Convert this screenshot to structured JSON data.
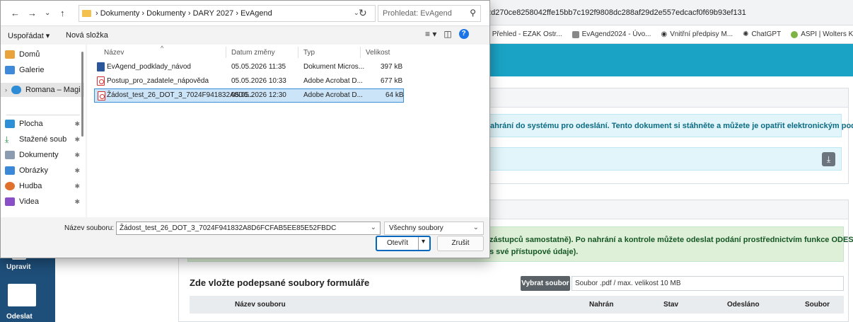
{
  "browser": {
    "url_fragment": "2d270ce8258042ffe15bb7c192f9808dc288af29d2e557edcacf0f69b93ef131",
    "bookmarks": [
      {
        "label": "Přehled - EZAK Ostr...",
        "icon": "play-icon"
      },
      {
        "label": "EvAgend2024 - Úvo...",
        "icon": "evagend-icon"
      },
      {
        "label": "Vnitřní předpisy M...",
        "icon": "globe-icon"
      },
      {
        "label": "ChatGPT",
        "icon": "chatgpt-icon"
      },
      {
        "label": "ASPI | Wolters Kluw...",
        "icon": "aspi-icon"
      }
    ]
  },
  "page": {
    "info_text": "ahrání do systému pro odeslání. Tento dokument si stáhněte a můžete je opatřit elektronickým podpisem.",
    "success_line1": "zástupců samostatně). Po nahrání a kontrole můžete odeslat podání prostřednictvím funkce ODESLAT.",
    "success_line2": "s své přístupové údaje).",
    "upload_title": "Zde vložte podepsané soubory formuláře",
    "pick_button": "Vybrat soubor",
    "pick_placeholder": "Soubor .pdf / max. velikost 10 MB",
    "table_headers": [
      "Název souboru",
      "Nahrán",
      "Stav",
      "Odesláno",
      "Soubor"
    ],
    "sidebar": {
      "edit_label": "Upravit",
      "send_label": "Odeslat"
    }
  },
  "dialog": {
    "breadcrumb": [
      "Dokumenty",
      "Dokumenty",
      "DARY 2027",
      "EvAgend"
    ],
    "search_placeholder": "Prohledat: EvAgend",
    "toolbar": {
      "organize": "Uspořádat ▾",
      "new_folder": "Nová složka"
    },
    "nav_items": [
      {
        "label": "Domů",
        "icon": "home-icon",
        "pinned": false
      },
      {
        "label": "Galerie",
        "icon": "gallery-icon",
        "pinned": false
      },
      {
        "label": "Romana – Magi",
        "icon": "cloud-icon",
        "pinned": false
      },
      {
        "label": "Plocha",
        "icon": "desktop-icon",
        "pinned": true
      },
      {
        "label": "Stažené soub",
        "icon": "download-icon",
        "pinned": true
      },
      {
        "label": "Dokumenty",
        "icon": "documents-icon",
        "pinned": true
      },
      {
        "label": "Obrázky",
        "icon": "pictures-icon",
        "pinned": true
      },
      {
        "label": "Hudba",
        "icon": "music-icon",
        "pinned": true
      },
      {
        "label": "Videa",
        "icon": "videos-icon",
        "pinned": true
      }
    ],
    "columns": {
      "name": "Název",
      "date": "Datum změny",
      "type": "Typ",
      "size": "Velikost"
    },
    "files": [
      {
        "name": "EvAgend_podklady_návod",
        "date": "05.05.2026 11:35",
        "type": "Dokument Micros...",
        "size": "397 kB",
        "icon": "word-file-icon"
      },
      {
        "name": "Postup_pro_zadatele_nápověda",
        "date": "05.05.2026 10:33",
        "type": "Adobe Acrobat D...",
        "size": "677 kB",
        "icon": "pdf-file-icon"
      },
      {
        "name": "Žádost_test_26_DOT_3_7024F941832A8D6...",
        "date": "05.05.2026 12:30",
        "type": "Adobe Acrobat D...",
        "size": "64 kB",
        "icon": "pdf-file-icon",
        "selected": true
      }
    ],
    "filename_label": "Název souboru:",
    "filename_value": "Žádost_test_26_DOT_3_7024F941832A8D6FCFAB5EE85E52FBDC",
    "filetype_value": "Všechny soubory",
    "open_button": "Otevřít",
    "cancel_button": "Zrušit"
  }
}
